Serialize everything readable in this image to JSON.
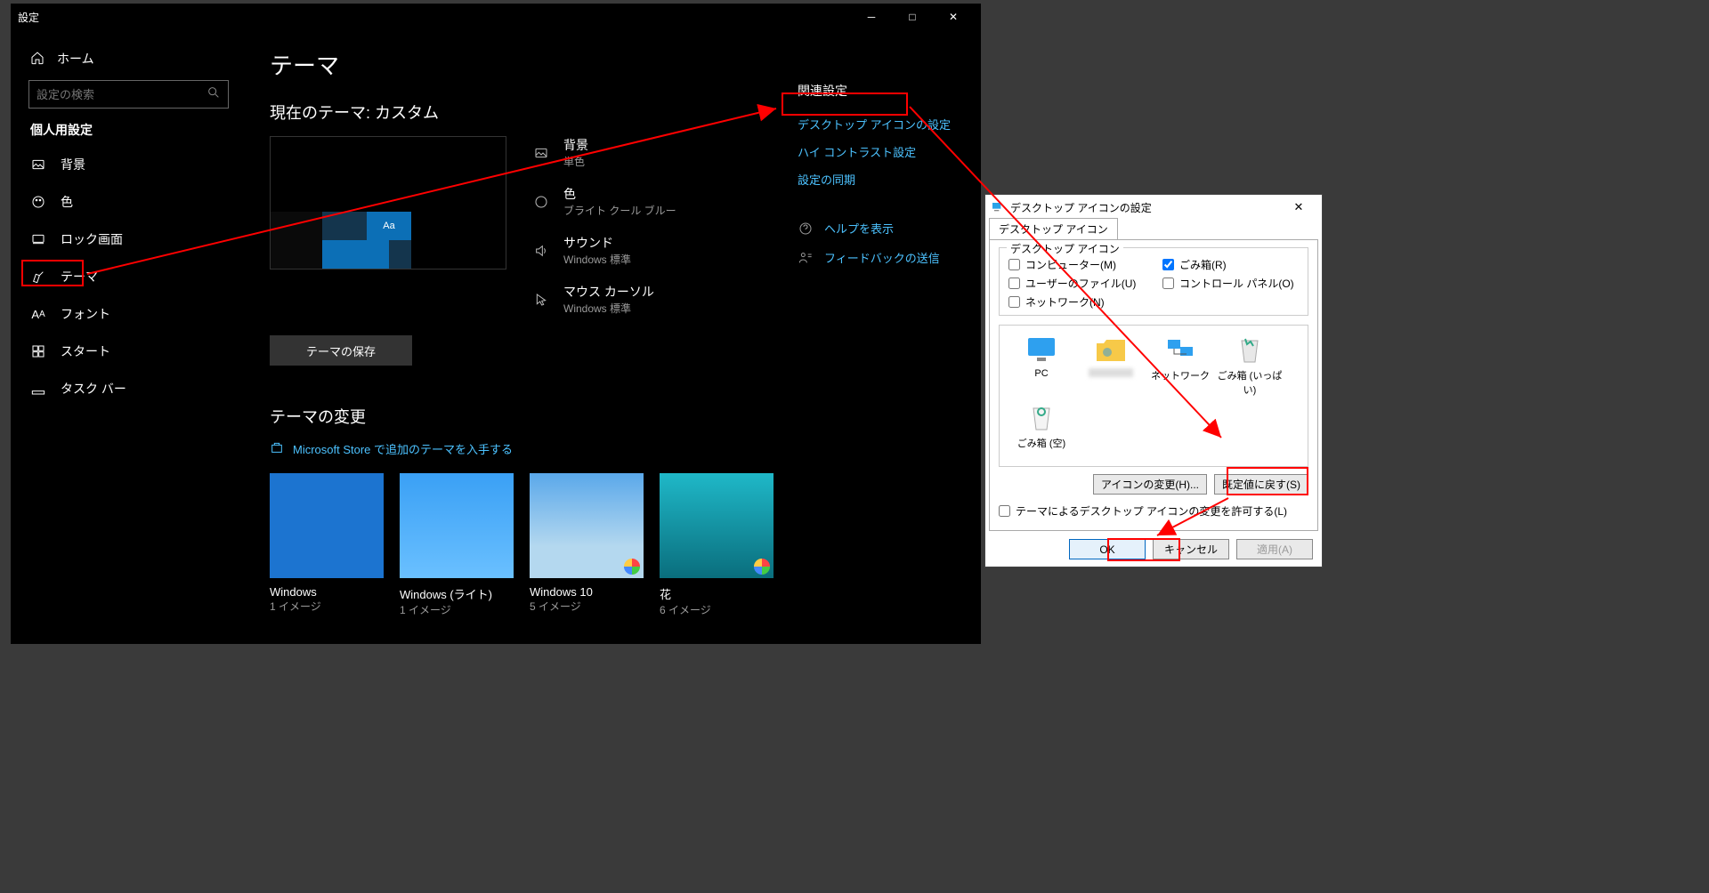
{
  "window": {
    "title": "設定",
    "home": "ホーム",
    "search_placeholder": "設定の検索",
    "section_header": "個人用設定",
    "nav": [
      {
        "label": "背景"
      },
      {
        "label": "色"
      },
      {
        "label": "ロック画面"
      },
      {
        "label": "テーマ"
      },
      {
        "label": "フォント"
      },
      {
        "label": "スタート"
      },
      {
        "label": "タスク バー"
      }
    ]
  },
  "main": {
    "title": "テーマ",
    "current_header": "現在のテーマ: カスタム",
    "preview_aa": "Aa",
    "props": {
      "background": {
        "label": "背景",
        "value": "単色"
      },
      "color": {
        "label": "色",
        "value": "ブライト クール ブルー"
      },
      "sound": {
        "label": "サウンド",
        "value": "Windows 標準"
      },
      "cursor": {
        "label": "マウス カーソル",
        "value": "Windows 標準"
      }
    },
    "save_button": "テーマの保存",
    "change_header": "テーマの変更",
    "store_link": "Microsoft Store で追加のテーマを入手する",
    "themes": [
      {
        "name": "Windows",
        "count": "1 イメージ"
      },
      {
        "name": "Windows (ライト)",
        "count": "1 イメージ"
      },
      {
        "name": "Windows 10",
        "count": "5 イメージ"
      },
      {
        "name": "花",
        "count": "6 イメージ"
      }
    ]
  },
  "related": {
    "header": "関連設定",
    "links": {
      "desktop_icons": "デスクトップ アイコンの設定",
      "high_contrast": "ハイ コントラスト設定",
      "sync": "設定の同期"
    },
    "help": "ヘルプを表示",
    "feedback": "フィードバックの送信"
  },
  "dialog": {
    "title": "デスクトップ アイコンの設定",
    "tab": "デスクトップ アイコン",
    "group_legend": "デスクトップ アイコン",
    "checks": {
      "computer": "コンピューター(M)",
      "recycle": "ごみ箱(R)",
      "userfiles": "ユーザーのファイル(U)",
      "cpl": "コントロール パネル(O)",
      "network": "ネットワーク(N)"
    },
    "icons": {
      "pc": "PC",
      "user": "",
      "network": "ネットワーク",
      "recycle_full": "ごみ箱 (いっぱい)",
      "recycle_empty": "ごみ箱 (空)"
    },
    "change_icon_btn": "アイコンの変更(H)...",
    "restore_btn": "既定値に戻す(S)",
    "permit": "テーマによるデスクトップ アイコンの変更を許可する(L)",
    "ok": "OK",
    "cancel": "キャンセル",
    "apply": "適用(A)"
  }
}
